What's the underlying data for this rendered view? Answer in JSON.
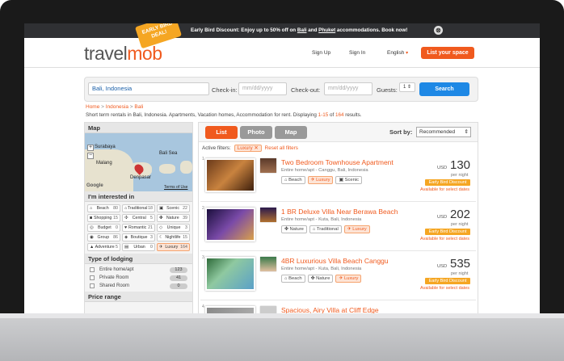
{
  "promo": {
    "tag": "EARLY BIRD DEAL!",
    "text_before": "Early Bird Discount: Enjoy up to 50% off on ",
    "link1": "Bali",
    "text_mid": " and ",
    "link2": "Phuket",
    "text_after": " accommodations. Book now!",
    "close": "⊗"
  },
  "header": {
    "logo_part1": "travel",
    "logo_part2": "mob",
    "signup": "Sign Up",
    "signin": "Sign In",
    "language": "English",
    "list_space": "List your space"
  },
  "search": {
    "destination": "Bali, Indonesia",
    "checkin_label": "Check-in:",
    "checkin_placeholder": "mm/dd/yyyy",
    "checkout_label": "Check-out:",
    "checkout_placeholder": "mm/dd/yyyy",
    "guests_label": "Guests:",
    "guests_value": "1",
    "button": "Search"
  },
  "breadcrumb": [
    "Home",
    "Indonesia",
    "Bali"
  ],
  "breadcrumb_sep": ">",
  "summary": {
    "text": "Short term rentals in Bali, Indonesia. Apartments, Vacation homes, Accommodation for rent. Displaying ",
    "range": "1-15",
    "of": " of ",
    "total": "164",
    "end": " results."
  },
  "sidebar": {
    "map_title": "Map",
    "map_labels": [
      "Surabaya",
      "Malang",
      "Bali Sea",
      "Denpasar"
    ],
    "map_google": "Google",
    "map_terms": "Terms of Use",
    "interest_title": "I'm interested in",
    "interests": [
      {
        "label": "Beach",
        "count": "80"
      },
      {
        "label": "Traditional",
        "count": "18"
      },
      {
        "label": "Scenic",
        "count": "22"
      },
      {
        "label": "Shopping",
        "count": "15"
      },
      {
        "label": "Central",
        "count": "5"
      },
      {
        "label": "Nature",
        "count": "39"
      },
      {
        "label": "Budget",
        "count": "0"
      },
      {
        "label": "Romantic",
        "count": "21"
      },
      {
        "label": "Unique",
        "count": "3"
      },
      {
        "label": "Group",
        "count": "86"
      },
      {
        "label": "Boutique",
        "count": "3"
      },
      {
        "label": "Nightlife",
        "count": "15"
      },
      {
        "label": "Adventure",
        "count": "5"
      },
      {
        "label": "Urban",
        "count": "0"
      },
      {
        "label": "Luxury",
        "count": "164"
      }
    ],
    "lodging_title": "Type of lodging",
    "lodging": [
      {
        "label": "Entire home/apt",
        "count": "123"
      },
      {
        "label": "Private Room",
        "count": "41"
      },
      {
        "label": "Shared Room",
        "count": "0"
      }
    ],
    "price_title": "Price range"
  },
  "main": {
    "views": [
      "List",
      "Photo",
      "Map"
    ],
    "sort_label": "Sort by:",
    "sort_value": "Recommended",
    "filters_label": "Active filters:",
    "filter_chip": "Luxury ✕",
    "reset": "Reset all filters",
    "listings": [
      {
        "num": "1",
        "title": "Two Bedroom Townhouse Apartment",
        "sub": "Entire home/apt - Canggu, Bali, Indonesia",
        "amenities": [
          "Beach",
          "Luxury",
          "Scenic"
        ],
        "currency": "USD",
        "price": "130",
        "per": "per night",
        "badge": "Early Bird Discount",
        "avail": "Available for select dates"
      },
      {
        "num": "2",
        "title": "1 BR Deluxe Villa Near Berawa Beach",
        "sub": "Entire home/apt - Kuta, Bali, Indonesia",
        "amenities": [
          "Nature",
          "Traditional",
          "Luxury"
        ],
        "currency": "USD",
        "price": "202",
        "per": "per night",
        "badge": "Early Bird Discount",
        "avail": "Available for select dates"
      },
      {
        "num": "3",
        "title": "4BR Luxurious Villa Beach Canggu",
        "sub": "Entire home/apt - Kuta, Bali, Indonesia",
        "amenities": [
          "Beach",
          "Nature",
          "Luxury"
        ],
        "currency": "USD",
        "price": "535",
        "per": "per night",
        "badge": "Early Bird Discount",
        "avail": "Available for select dates"
      },
      {
        "num": "4",
        "title": "Spacious, Airy Villa at Cliff Edge"
      }
    ]
  }
}
